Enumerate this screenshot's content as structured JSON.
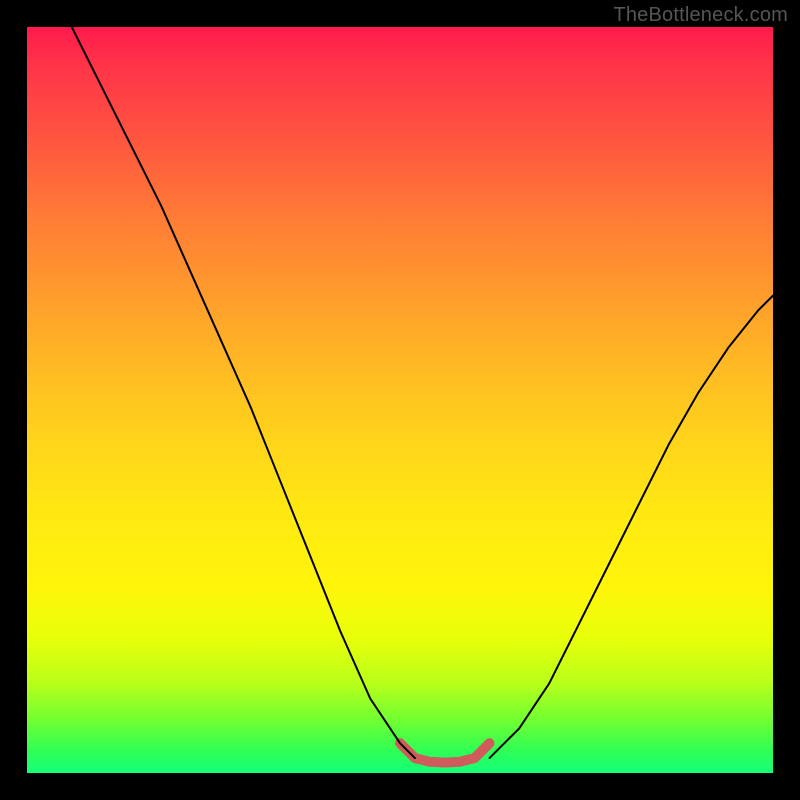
{
  "watermark": "TheBottleneck.com",
  "chart_data": {
    "type": "line",
    "title": "",
    "xlabel": "",
    "ylabel": "",
    "xlim": [
      0,
      100
    ],
    "ylim": [
      0,
      100
    ],
    "grid": false,
    "series": [
      {
        "name": "curve-left",
        "x": [
          6,
          10,
          14,
          18,
          22,
          26,
          30,
          34,
          38,
          42,
          46,
          50,
          52
        ],
        "values": [
          100,
          92,
          84,
          76,
          67,
          58,
          49,
          39,
          29,
          19,
          10,
          4,
          2
        ],
        "stroke": "#000000",
        "width": 2
      },
      {
        "name": "curve-right",
        "x": [
          62,
          66,
          70,
          74,
          78,
          82,
          86,
          90,
          94,
          98,
          100
        ],
        "values": [
          2,
          6,
          12,
          20,
          28,
          36,
          44,
          51,
          57,
          62,
          64
        ],
        "stroke": "#000000",
        "width": 2
      },
      {
        "name": "flat-highlight",
        "x": [
          50,
          52,
          54,
          56,
          58,
          60,
          62
        ],
        "values": [
          4,
          2,
          1.5,
          1.4,
          1.5,
          2,
          4
        ],
        "stroke": "#cf5b5b",
        "width": 10
      }
    ]
  }
}
